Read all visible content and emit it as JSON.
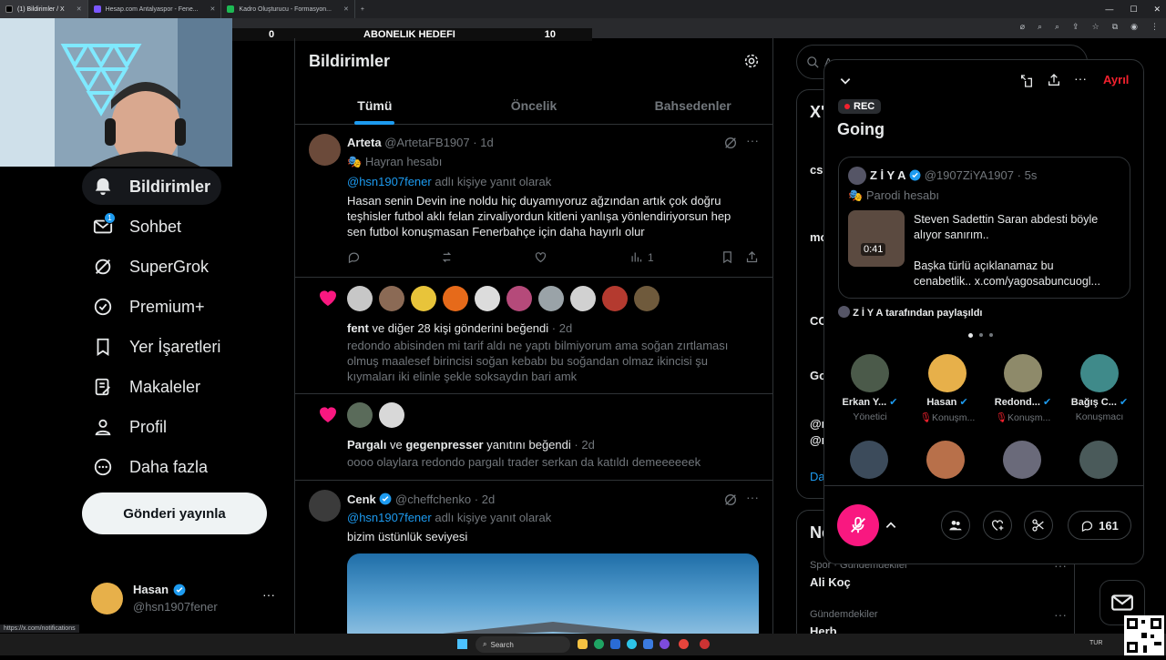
{
  "browser": {
    "tabs": [
      {
        "label": "(1) Bildirimler / X",
        "color": "#000000"
      },
      {
        "label": "Hesap.com Antalyaspor - Fene...",
        "color": "#7b57ff"
      },
      {
        "label": "Kadro Oluşturucu - Formasyon...",
        "color": "#1db954"
      }
    ],
    "new_tab": "+",
    "status_url": "https://x.com/notifications"
  },
  "overlay": {
    "left_value": "0",
    "title": "ABONELIK HEDEFI",
    "right_value": "10"
  },
  "sidebar": {
    "items": [
      {
        "label": "Bildirimler",
        "icon": "bell-icon",
        "active": true
      },
      {
        "label": "Sohbet",
        "icon": "mail-icon",
        "badge": "1"
      },
      {
        "label": "SuperGrok",
        "icon": "grok-icon"
      },
      {
        "label": "Premium+",
        "icon": "verified-icon"
      },
      {
        "label": "Yer İşaretleri",
        "icon": "bookmark-icon"
      },
      {
        "label": "Makaleler",
        "icon": "article-icon"
      },
      {
        "label": "Profil",
        "icon": "person-icon"
      },
      {
        "label": "Daha fazla",
        "icon": "more-circle-icon"
      }
    ],
    "post_button": "Gönderi yayınla",
    "account": {
      "name": "Hasan",
      "handle": "@hsn1907fener",
      "more": "···"
    }
  },
  "main": {
    "title": "Bildirimler",
    "tabs": [
      "Tümü",
      "Öncelik",
      "Bahsedenler"
    ],
    "post1": {
      "name": "Arteta",
      "handle": "@ArtetaFB1907",
      "sep": "·",
      "time": "1d",
      "label": "Hayran hesabı",
      "reply_to": "@hsn1907fener",
      "reply_suffix": "adlı kişiye yanıt olarak",
      "text_lines": [
        "Hasan senin Devin ine noldu hiç duyamıyoruz ağzından artık çok doğru",
        "teşhisler futbol aklı felan zirvaliyordun kitleni yanlışa yönlendiriyorsun hep",
        "sen futbol konuşmasan Fenerbahçe için daha hayırlı olur"
      ],
      "views": "1"
    },
    "like1": {
      "actors": "fent",
      "rest": "ve diğer 28 kişi gönderini beğendi",
      "sep": "·",
      "time": "2d",
      "text_lines": [
        "redondo abisinden mi tarif aldı ne yaptı bilmiyorum ama soğan zırtlaması",
        "olmuş maalesef birincisi soğan kebabı bu soğandan olmaz  ikincisi şu",
        "kıymaları iki elinle şekle soksaydın bari amk"
      ]
    },
    "like2": {
      "actor1": "Pargalı",
      "and": "ve",
      "actor2": "gegenpresser",
      "rest": "yanıtını beğendi",
      "sep": "·",
      "time": "2d",
      "text": "oooo olaylara redondo pargalı trader serkan da katıldı demeeeeeek"
    },
    "post2": {
      "name": "Cenk",
      "handle": "@cheffchenko",
      "sep": "·",
      "time": "2d",
      "reply_to": "@hsn1907fener",
      "reply_suffix": "adlı kişiye yanıt olarak",
      "text": "bizim üstünlük seviyesi"
    }
  },
  "right": {
    "search_placeholder": "A",
    "card1": {
      "heading": "X'",
      "frags": [
        "cs",
        "mo",
        "CC",
        "Go",
        "@r",
        "@r",
        "Da"
      ]
    },
    "card2": {
      "heading": "Ne",
      "trend1_cat": "Spor · Gündemdekiler",
      "trend1_name": "Ali Koç",
      "trend2_cat": "Gündemdekiler",
      "trend2_name": "Herb"
    }
  },
  "space": {
    "leave": "Ayrıl",
    "rec": "REC",
    "title": "Going",
    "pinned": {
      "name": "Z İ Y A",
      "handle": "@1907ZiYA1907",
      "sep": "·",
      "time": "5s",
      "label": "Parodi hesabı",
      "duration": "0:41",
      "text_lines": [
        "Steven Sadettin Saran abdesti böyle",
        "alıyor sanırım..",
        "",
        " Başka türlü açıklanamaz bu",
        "cenabetlik..  x.com/yagosabuncuogl..."
      ],
      "shared_by": "Z İ Y A tarafından paylaşıldı"
    },
    "speakers": [
      {
        "name": "Erkan Y...",
        "role": "Yönetici",
        "muted": false
      },
      {
        "name": "Hasan",
        "role": "Konuşm...",
        "muted": true
      },
      {
        "name": "Redond...",
        "role": "Konuşm...",
        "muted": true
      },
      {
        "name": "Bağış C...",
        "role": "Konuşmacı",
        "muted": false
      }
    ],
    "comment_count": "161"
  },
  "taskbar": {
    "search": "Search",
    "lang": "TUR"
  }
}
